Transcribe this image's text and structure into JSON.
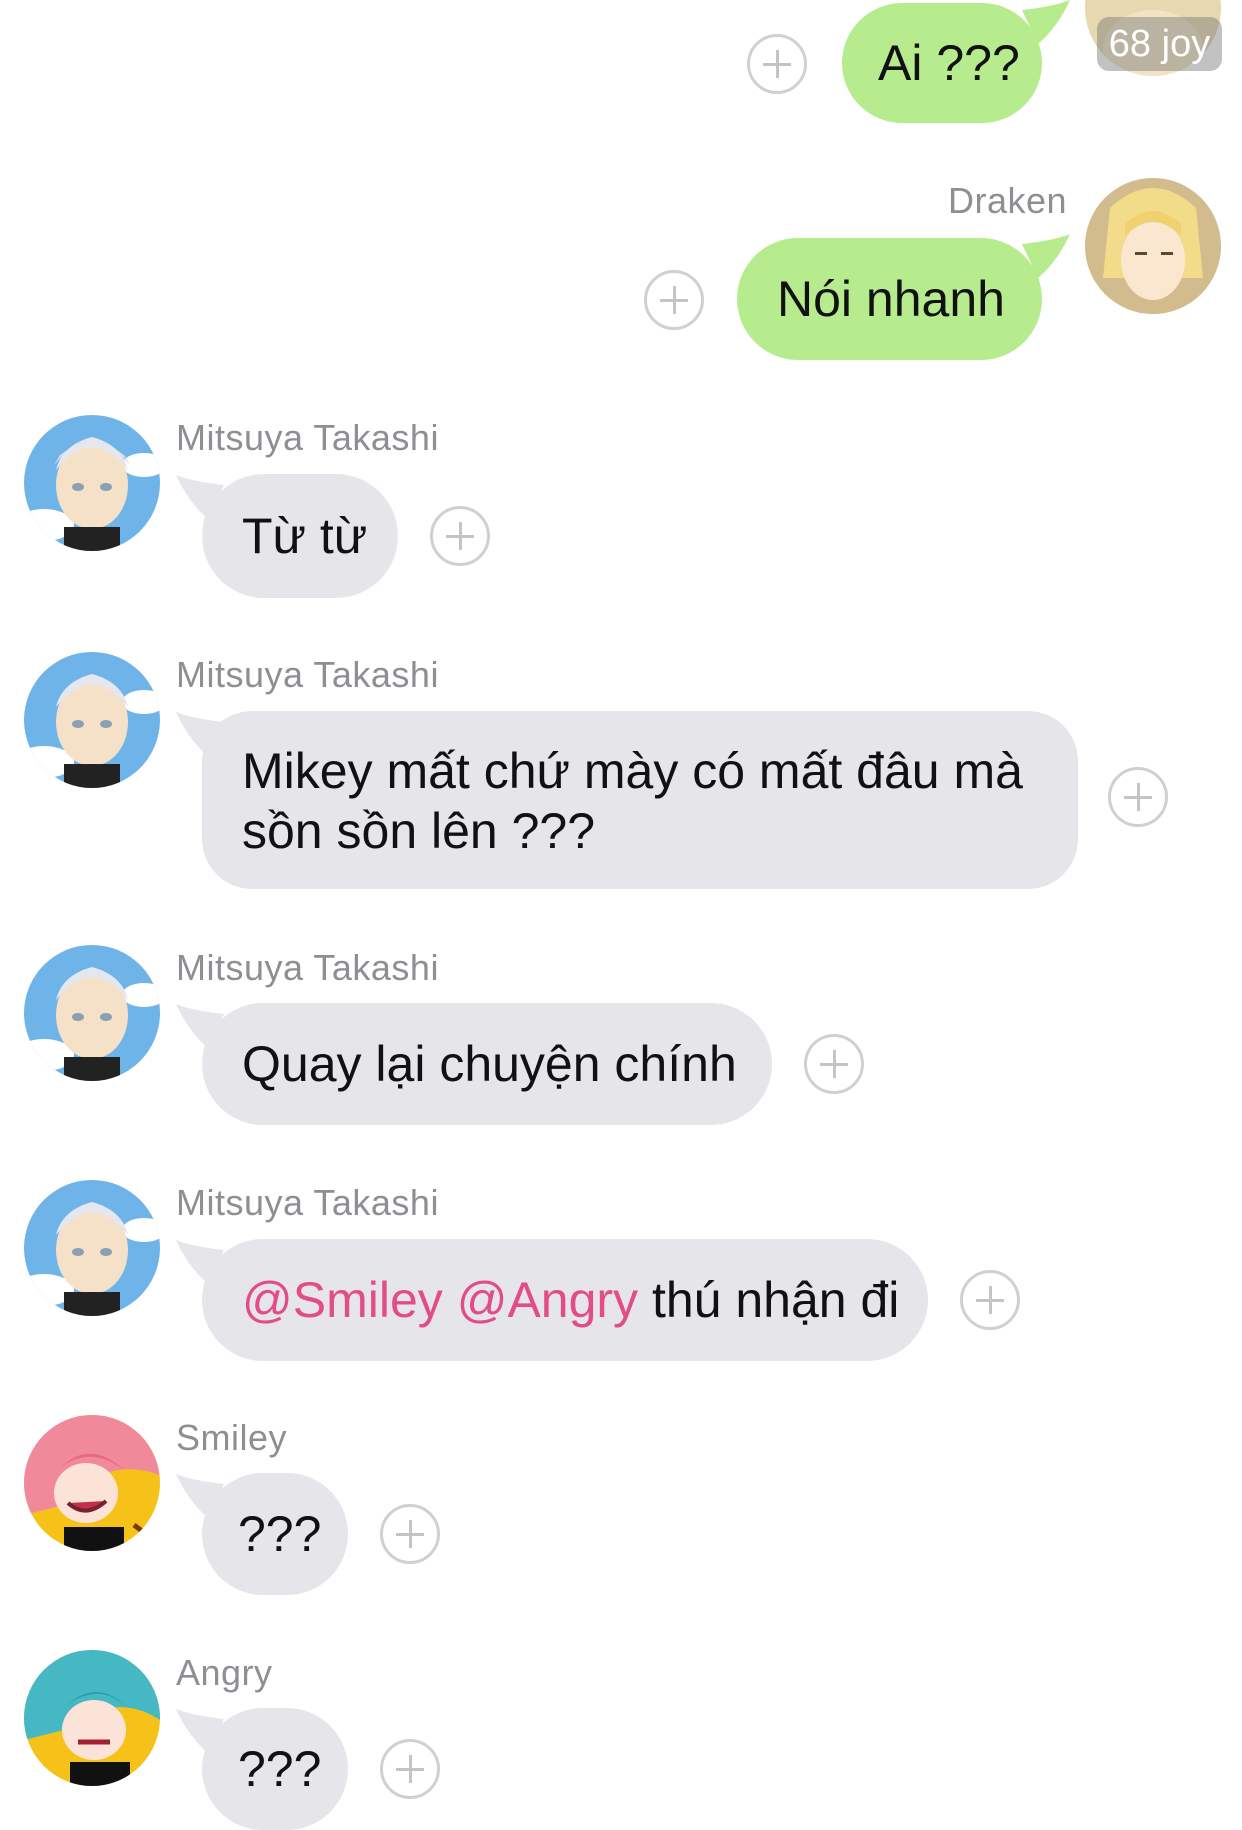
{
  "messages": [
    {
      "sender": "",
      "text": "Ai ???",
      "side": "outgoing"
    },
    {
      "sender": "Draken",
      "text": "Nói nhanh",
      "side": "outgoing"
    },
    {
      "sender": "Mitsuya Takashi",
      "text": "Từ từ",
      "side": "incoming"
    },
    {
      "sender": "Mitsuya Takashi",
      "text": "Mikey mất chứ mày có mất đâu mà sồn sồn lên ???",
      "side": "incoming"
    },
    {
      "sender": "Mitsuya Takashi",
      "text": "Quay lại chuyện chính",
      "side": "incoming"
    },
    {
      "sender": "Mitsuya Takashi",
      "mentions": [
        "@Smiley",
        "@Angry"
      ],
      "text": "thú nhận đi",
      "side": "incoming"
    },
    {
      "sender": "Smiley",
      "text": "???",
      "side": "incoming"
    },
    {
      "sender": "Angry",
      "text": "???",
      "side": "incoming"
    }
  ],
  "read_badge": "68 joy",
  "icons": {
    "reaction": "plus-circle-icon",
    "avatar": "avatar"
  },
  "colors": {
    "outgoing_bubble": "#b6ec8e",
    "incoming_bubble": "#e6e6ea",
    "mention": "#e24d85",
    "sender_name": "#8e8e93"
  }
}
